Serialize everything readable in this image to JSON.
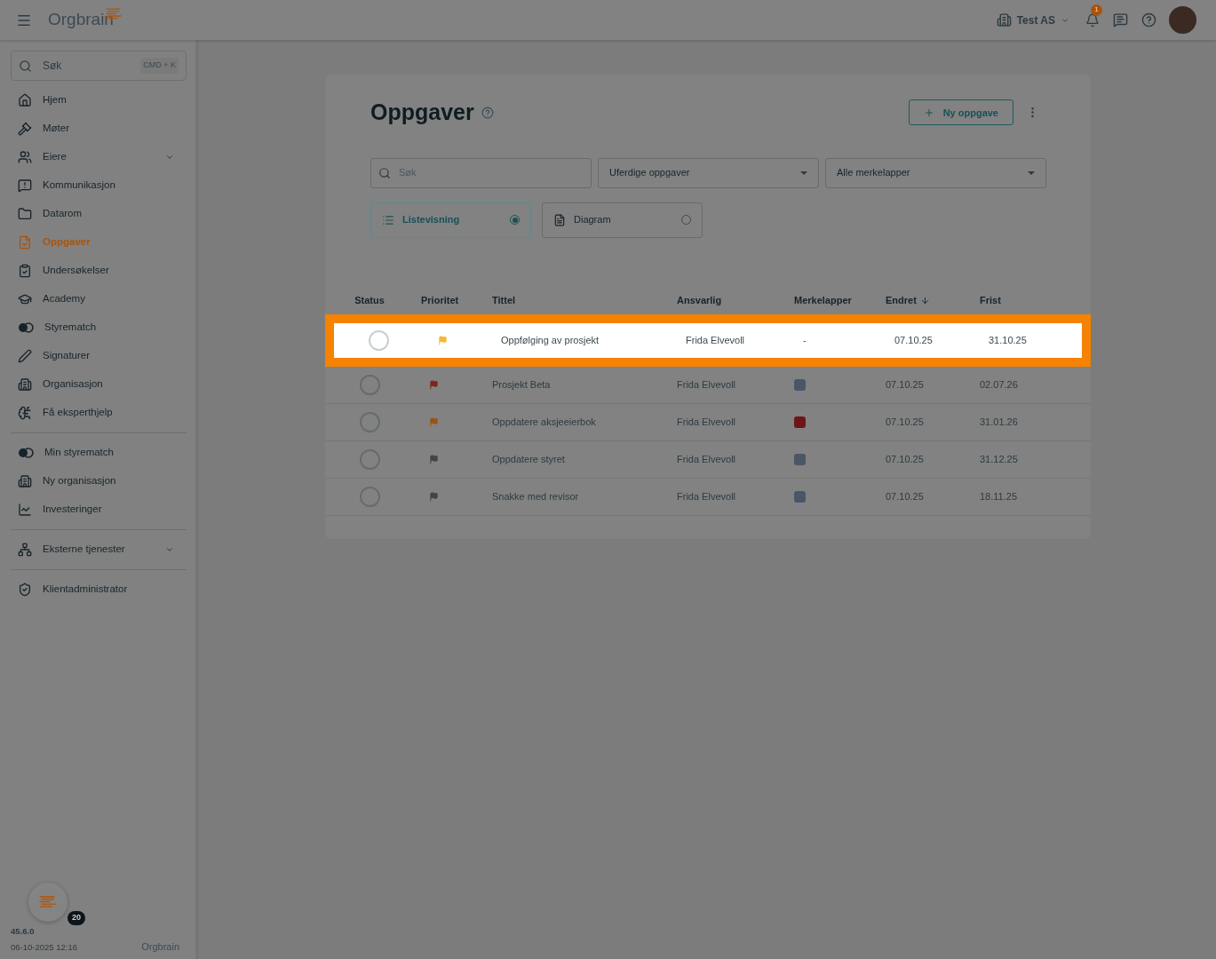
{
  "header": {
    "logo": "Orgbrain",
    "company": "Test AS",
    "notification_count": "1"
  },
  "sidebar": {
    "search": {
      "placeholder": "Søk",
      "shortcut": "CMD + K"
    },
    "groups": [
      [
        {
          "label": "Hjem",
          "kind": "home",
          "selected": false,
          "expandable": false
        },
        {
          "label": "Møter",
          "kind": "gavel",
          "selected": false,
          "expandable": false
        },
        {
          "label": "Eiere",
          "kind": "users",
          "selected": false,
          "expandable": true
        },
        {
          "label": "Kommunikasjon",
          "kind": "message",
          "selected": false,
          "expandable": false
        },
        {
          "label": "Datarom",
          "kind": "folder",
          "selected": false,
          "expandable": false
        },
        {
          "label": "Oppgaver",
          "kind": "task",
          "selected": true,
          "expandable": false
        },
        {
          "label": "Undersøkelser",
          "kind": "clipboard",
          "selected": false,
          "expandable": false
        },
        {
          "label": "Academy",
          "kind": "cap",
          "selected": false,
          "expandable": false
        },
        {
          "label": "Styrematch",
          "kind": "circles",
          "selected": false,
          "expandable": false
        },
        {
          "label": "Signaturer",
          "kind": "pen",
          "selected": false,
          "expandable": false
        },
        {
          "label": "Organisasjon",
          "kind": "building",
          "selected": false,
          "expandable": false
        },
        {
          "label": "Få eksperthjelp",
          "kind": "head",
          "selected": false,
          "expandable": false
        }
      ],
      [
        {
          "label": "Min styrematch",
          "kind": "circles",
          "selected": false,
          "expandable": false
        },
        {
          "label": "Ny organisasjon",
          "kind": "building",
          "selected": false,
          "expandable": false
        },
        {
          "label": "Investeringer",
          "kind": "chart",
          "selected": false,
          "expandable": false
        }
      ],
      [
        {
          "label": "Eksterne tjenester",
          "kind": "network",
          "selected": false,
          "expandable": true
        }
      ],
      [
        {
          "label": "Klientadministrator",
          "kind": "shield",
          "selected": false,
          "expandable": false
        }
      ]
    ],
    "badge_count": "20",
    "version": "45.6.0",
    "build_date": "06-10-2025 12:16",
    "footer_logo": "Orgbrain"
  },
  "page": {
    "title": "Oppgaver",
    "new_button": "Ny oppgave",
    "filters": {
      "search_placeholder": "Søk",
      "status": "Uferdige oppgaver",
      "tags": "Alle merkelapper"
    },
    "views": [
      {
        "label": "Listevisning",
        "kind": "list",
        "selected": true
      },
      {
        "label": "Diagram",
        "kind": "diagram",
        "selected": false
      }
    ],
    "table": {
      "columns": [
        "Status",
        "Prioritet",
        "Tittel",
        "Ansvarlig",
        "Merkelapper",
        "Endret",
        "Frist"
      ],
      "rows": [
        {
          "highlighted": true,
          "priority": {
            "color": "#f5b733"
          },
          "title": "Oppfølging av prosjekt",
          "owner": "Frida Elvevoll",
          "tag": {
            "label": "-"
          },
          "changed": "07.10.25",
          "due": "31.10.25"
        },
        {
          "highlighted": false,
          "priority": {
            "color": "#7a2a18"
          },
          "title": "Prosjekt Beta",
          "owner": "Frida Elvevoll",
          "tag": {
            "color": "#4a5668"
          },
          "changed": "07.10.25",
          "due": "02.07.26"
        },
        {
          "highlighted": false,
          "priority": {
            "color": "#9a5410"
          },
          "title": "Oppdatere aksjeeierbok",
          "owner": "Frida Elvevoll",
          "tag": {
            "color": "#6e1616"
          },
          "changed": "07.10.25",
          "due": "31.01.26"
        },
        {
          "highlighted": false,
          "priority": {
            "color": "#444444"
          },
          "title": "Oppdatere styret",
          "owner": "Frida Elvevoll",
          "tag": {
            "color": "#4a5668"
          },
          "changed": "07.10.25",
          "due": "31.12.25"
        },
        {
          "highlighted": false,
          "priority": {
            "color": "#444444"
          },
          "title": "Snakke med revisor",
          "owner": "Frida Elvevoll",
          "tag": {
            "color": "#4a5668"
          },
          "changed": "07.10.25",
          "due": "18.11.25"
        }
      ]
    }
  }
}
